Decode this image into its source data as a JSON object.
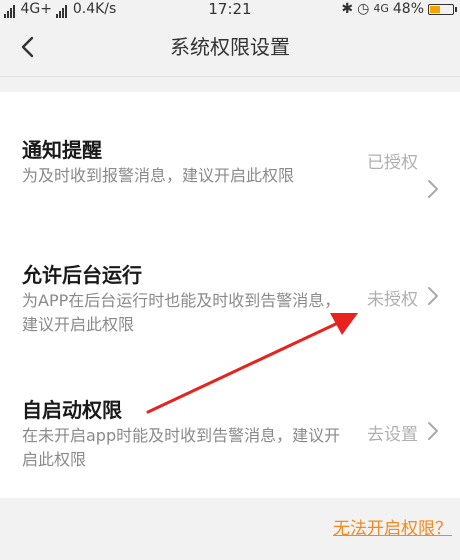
{
  "status_bar": {
    "left_text": "4G+",
    "speed": "0.4K/s",
    "time": "17:21",
    "network_right": "4G",
    "battery": "48%",
    "battery_level": 0.48
  },
  "header": {
    "title": "系统权限设置"
  },
  "permissions": [
    {
      "title": "通知提醒",
      "description": "为及时收到报警消息，建议开启此权限",
      "status": "已授权"
    },
    {
      "title": "允许后台运行",
      "description": "为APP在后台运行时也能及时收到告警消息，建议开启此权限",
      "status": "未授权"
    },
    {
      "title": "自启动权限",
      "description": "在未开启app时能及时收到告警消息，建议开启此权限",
      "status": "去设置"
    }
  ],
  "footer": {
    "help_link": "无法开启权限？"
  },
  "colors": {
    "accent": "#f28a1e",
    "arrow": "#e8231f"
  }
}
